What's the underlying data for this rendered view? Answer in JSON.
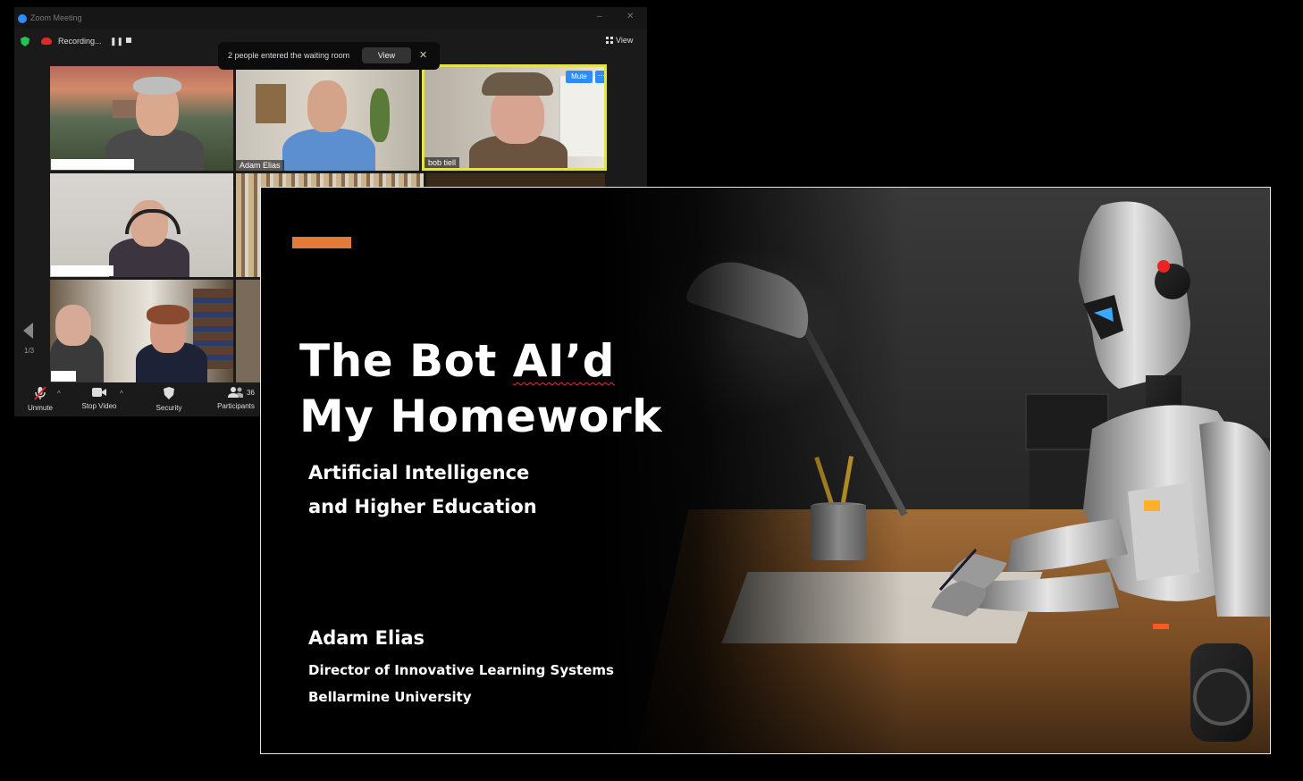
{
  "zoom": {
    "window_title": "Zoom Meeting",
    "recording_label": "Recording...",
    "view_label": "View",
    "toast": {
      "message": "2 people entered the waiting room",
      "view_button": "View",
      "close_symbol": "✕"
    },
    "tiles": [
      {
        "name": ""
      },
      {
        "name": "Adam Elias"
      },
      {
        "name": "bob tiell",
        "mute_badge": "Mute",
        "more_badge": "···"
      },
      {
        "name": ""
      },
      {
        "name": ""
      },
      {
        "name": ""
      }
    ],
    "page_indicator": "1/3",
    "toolbar": {
      "unmute": "Unmute",
      "stop_video": "Stop Video",
      "security": "Security",
      "participants": "Participants",
      "participant_count": "36"
    },
    "icons": {
      "shield": "shield-check-icon",
      "recording": "cloud-recording-icon",
      "mic": "mic-muted-icon",
      "video": "video-camera-icon",
      "security": "security-shield-icon",
      "participants": "participants-icon"
    }
  },
  "slide": {
    "title_line1_prefix": "The Bot ",
    "title_line1_word": "AI’d",
    "title_line2": "My Homework",
    "subtitle_line1": "Artificial Intelligence",
    "subtitle_line2": "and Higher Education",
    "presenter_name": "Adam Elias",
    "presenter_role": "Director of Innovative Learning Systems",
    "presenter_org": "Bellarmine University"
  },
  "colors": {
    "accent": "#e07b39",
    "zoom_blue": "#2d8cff",
    "active_speaker": "#e6e34a",
    "recording_red": "#e02828",
    "secure_green": "#23c552"
  }
}
